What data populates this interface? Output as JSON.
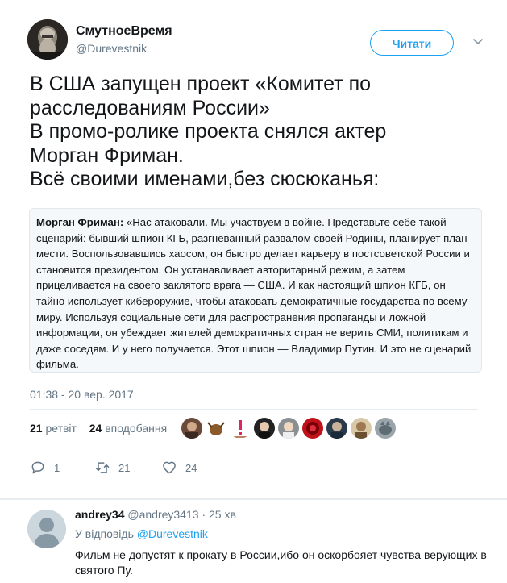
{
  "tweet": {
    "display_name": "СмутноеВремя",
    "handle": "@Durevestnik",
    "follow_label": "Читати",
    "text": "В США запущен проект «Комитет по\nрасследованиям России»\nВ промо-ролике проекта снялся актер\nМорган Фриман.\nВсё своими именами,без сюсюканья:",
    "quote_speaker": "Морган Фриман:",
    "quote_text": " «Нас атаковали. Мы участвуем в войне. Представьте себе такой сценарий: бывший шпион КГБ, разгневанный развалом своей Родины, планирует план мести. Воспользовавшись хаосом, он быстро делает карьеру в постсоветской России и становится президентом. Он устанавливает авторитарный режим, а затем прицеливается на своего заклятого врага — США. И как настоящий шпион КГБ, он тайно использует кибероружие, чтобы атаковать демократичные государства по всему миру. Используя социальные сети для распространения пропаганды и ложной информации, он убеждает жителей демократичных стран не верить СМИ, политикам и даже соседям. И у него получается. Этот шпион — Владимир Путин. И это не сценарий фильма.",
    "timestamp": "01:38 - 20 вер. 2017",
    "retweets_count": "21",
    "retweets_label": "ретвіт",
    "likes_count": "24",
    "likes_label": "вподобання"
  },
  "actions": {
    "reply_count": "1",
    "retweet_count": "21",
    "like_count": "24"
  },
  "reply": {
    "name": "andrey34",
    "handle": "@andrey3413",
    "time": "· 25 хв",
    "reply_to_prefix": "У відповідь",
    "reply_to_handle": "@Durevestnik",
    "text": "Фильм не допустят к прокату в России,ибо он  оскорбояет чувства верующих в святого Пу."
  },
  "colors": {
    "accent": "#1da1f2",
    "secondary_text": "#657786",
    "quote_bg": "#f5f8fa",
    "border": "#e1e8ed"
  }
}
